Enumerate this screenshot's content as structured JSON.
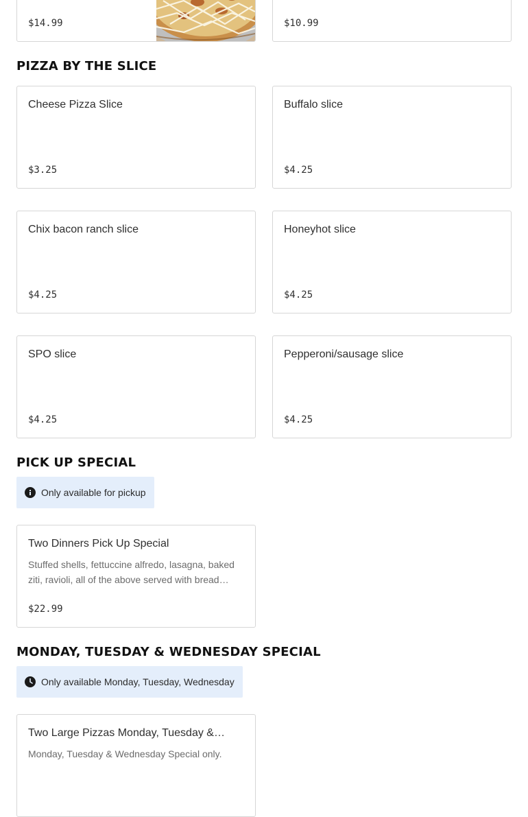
{
  "top_cards": {
    "left": {
      "price": "$14.99"
    },
    "right": {
      "price": "$10.99"
    }
  },
  "sections": {
    "slice": {
      "title": "PIZZA BY THE SLICE",
      "items": [
        {
          "name": "Cheese Pizza Slice",
          "price": "$3.25"
        },
        {
          "name": "Buffalo slice",
          "price": "$4.25"
        },
        {
          "name": "Chix bacon ranch slice",
          "price": "$4.25"
        },
        {
          "name": "Honeyhot slice",
          "price": "$4.25"
        },
        {
          "name": "SPO slice",
          "price": "$4.25"
        },
        {
          "name": "Pepperoni/sausage slice",
          "price": "$4.25"
        }
      ]
    },
    "pickup": {
      "title": "PICK UP SPECIAL",
      "notice": "Only available for pickup",
      "notice_icon": "info-icon",
      "items": [
        {
          "name": "Two Dinners Pick Up Special",
          "description": "Stuffed shells, fettuccine alfredo, lasagna, baked ziti, ravioli, all of the above served with bread…",
          "price": "$22.99"
        }
      ]
    },
    "mtw": {
      "title": "MONDAY, TUESDAY & WEDNESDAY SPECIAL",
      "notice": "Only available Monday, Tuesday, Wednesday",
      "notice_icon": "clock-icon",
      "items": [
        {
          "name": "Two Large Pizzas Monday, Tuesday &…",
          "description": "Monday, Tuesday & Wednesday Special only."
        }
      ]
    }
  }
}
